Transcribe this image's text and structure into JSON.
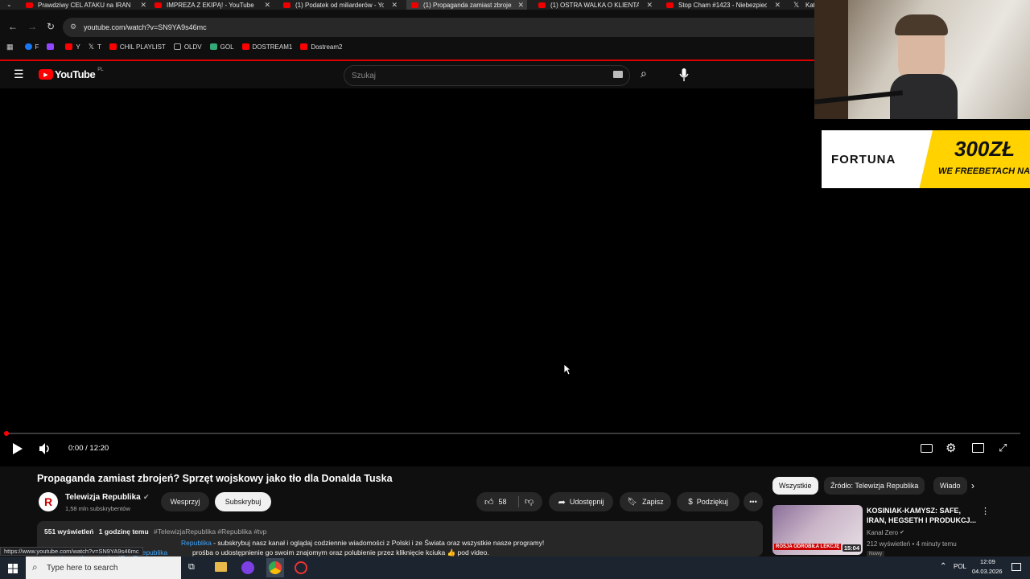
{
  "browser": {
    "tabs": [
      {
        "label": "Prawdziwy CEL ATAKU na IRAN",
        "active": false
      },
      {
        "label": "IMPREZA Z EKIPĄ! - YouTube",
        "active": false
      },
      {
        "label": "(1) Podatek od miliarderów - Yo",
        "active": false
      },
      {
        "label": "(1) Propaganda zamiast zbrojeń",
        "active": true
      },
      {
        "label": "(1) OSTRA WALKA O KLIENTA. ",
        "active": false
      },
      {
        "label": "Stop Cham #1423 - Niebezpiec",
        "active": false
      },
      {
        "label": "Kat",
        "active": false
      }
    ],
    "url": "youtube.com/watch?v=SN9YA9s46mc",
    "bookmarks": [
      {
        "label": "F",
        "color": "#1877f2"
      },
      {
        "label": "",
        "color": "#9146ff"
      },
      {
        "label": "Y",
        "color": "#ff0000"
      },
      {
        "label": "T",
        "color": "#ffffff"
      },
      {
        "label": "CHIL PLAYLIST",
        "color": "#ff0000"
      },
      {
        "label": "OLDV",
        "color": "#aaaaaa"
      },
      {
        "label": "GOL",
        "color": "#3a7"
      },
      {
        "label": "DOSTREAM1",
        "color": "#ff0000"
      },
      {
        "label": "Dostream2",
        "color": "#ff0000"
      }
    ],
    "status_url": "https://www.youtube.com/watch?v=SN9YA9s46mc"
  },
  "youtube": {
    "logo_text": "YouTube",
    "region": "PL",
    "search_placeholder": "Szukaj"
  },
  "player": {
    "time": "0:00 / 12:20",
    "progress": 0
  },
  "video": {
    "title": "Propaganda zamiast zbrojeń? Sprzęt wojskowy jako tło dla Donalda Tuska",
    "channel": "Telewizja Republika",
    "subscribers": "1,58 mln subskrybentów",
    "support_label": "Wesprzyj",
    "subscribe_label": "Subskrybuj",
    "likes": "58",
    "share_label": "Udostępnij",
    "save_label": "Zapisz",
    "thanks_label": "Podziękuj",
    "views": "551 wyświetleń",
    "age": "1 godzinę temu",
    "tags": "#TelewizjaRepublika #Republika #tvp",
    "desc_line1_link": "Republika",
    "desc_line1": " - subskrybuj nasz kanał i oglądaj codziennie wiadomości z Polski i ze Świata oraz wszystkie nasze programy!",
    "desc_line2_link": "http://bit.ly/Subskrybuj_TV_Republika",
    "desc_line3": "prośba o udostępnienie go swoim znajomym oraz polubienie przez kliknięcie kciuka 👍 pod video."
  },
  "sidebar": {
    "chips": [
      "Wszystkie",
      "Źródło: Telewizja Republika",
      "Wiado"
    ],
    "recommended": {
      "title": "KOSINIAK-KAMYSZ: SAFE, IRAN, HEGSETH I PRODUKCJ...",
      "channel": "Kanał Zero",
      "meta": "212 wyświetleń • 4 minuty temu",
      "badge": "Nowy",
      "duration": "15:04",
      "thumb_text": "ROSJA ODROBIŁA LEKCJĘ"
    }
  },
  "overlay": {
    "brand": "FORTUNA",
    "amount": "300ZŁ",
    "promo": "WE FREEBETACH NA START"
  },
  "taskbar": {
    "search_placeholder": "Type here to search",
    "lang": "POL",
    "time": "12:09",
    "date": "04.03.2026"
  }
}
